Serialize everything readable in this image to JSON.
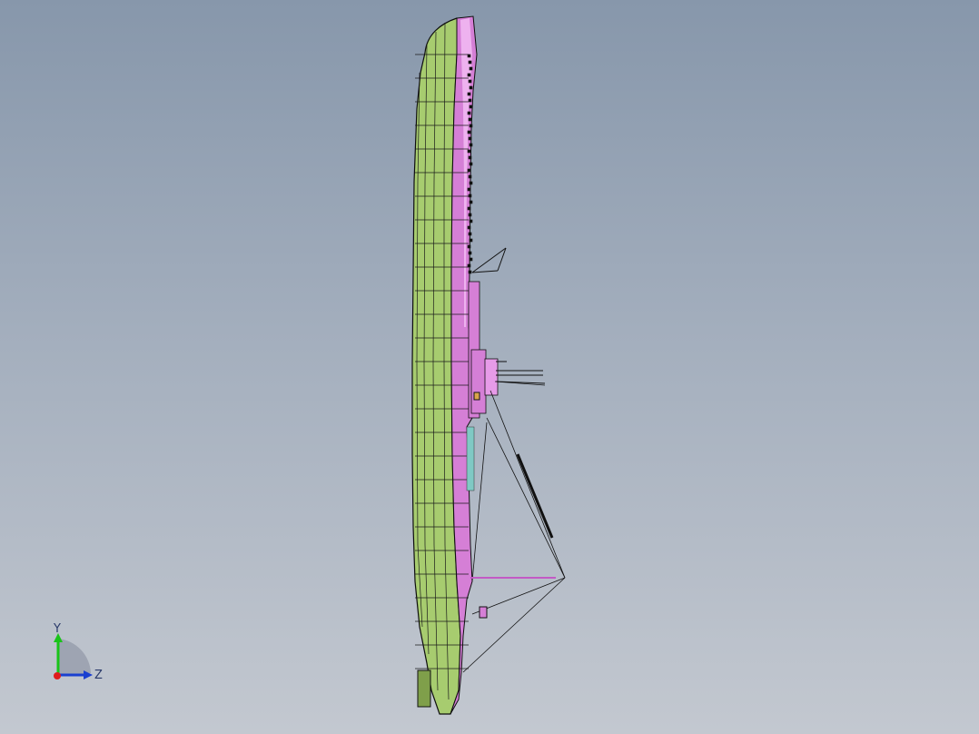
{
  "viewport": {
    "background_top": "#8797ab",
    "background_bottom": "#c3c8d0"
  },
  "model": {
    "hull_color": "#a7cc6f",
    "hull_dark": "#7f9f4a",
    "deck_color": "#d57fd6",
    "deck_light": "#eeb2ef",
    "outline_color": "#0e0e0e",
    "accent_cyan": "#7fc9c4"
  },
  "triad": {
    "x_color": "#e01b1b",
    "y_color": "#19c419",
    "z_color": "#1a3fd0",
    "y_label": "Y",
    "z_label": "Z"
  }
}
